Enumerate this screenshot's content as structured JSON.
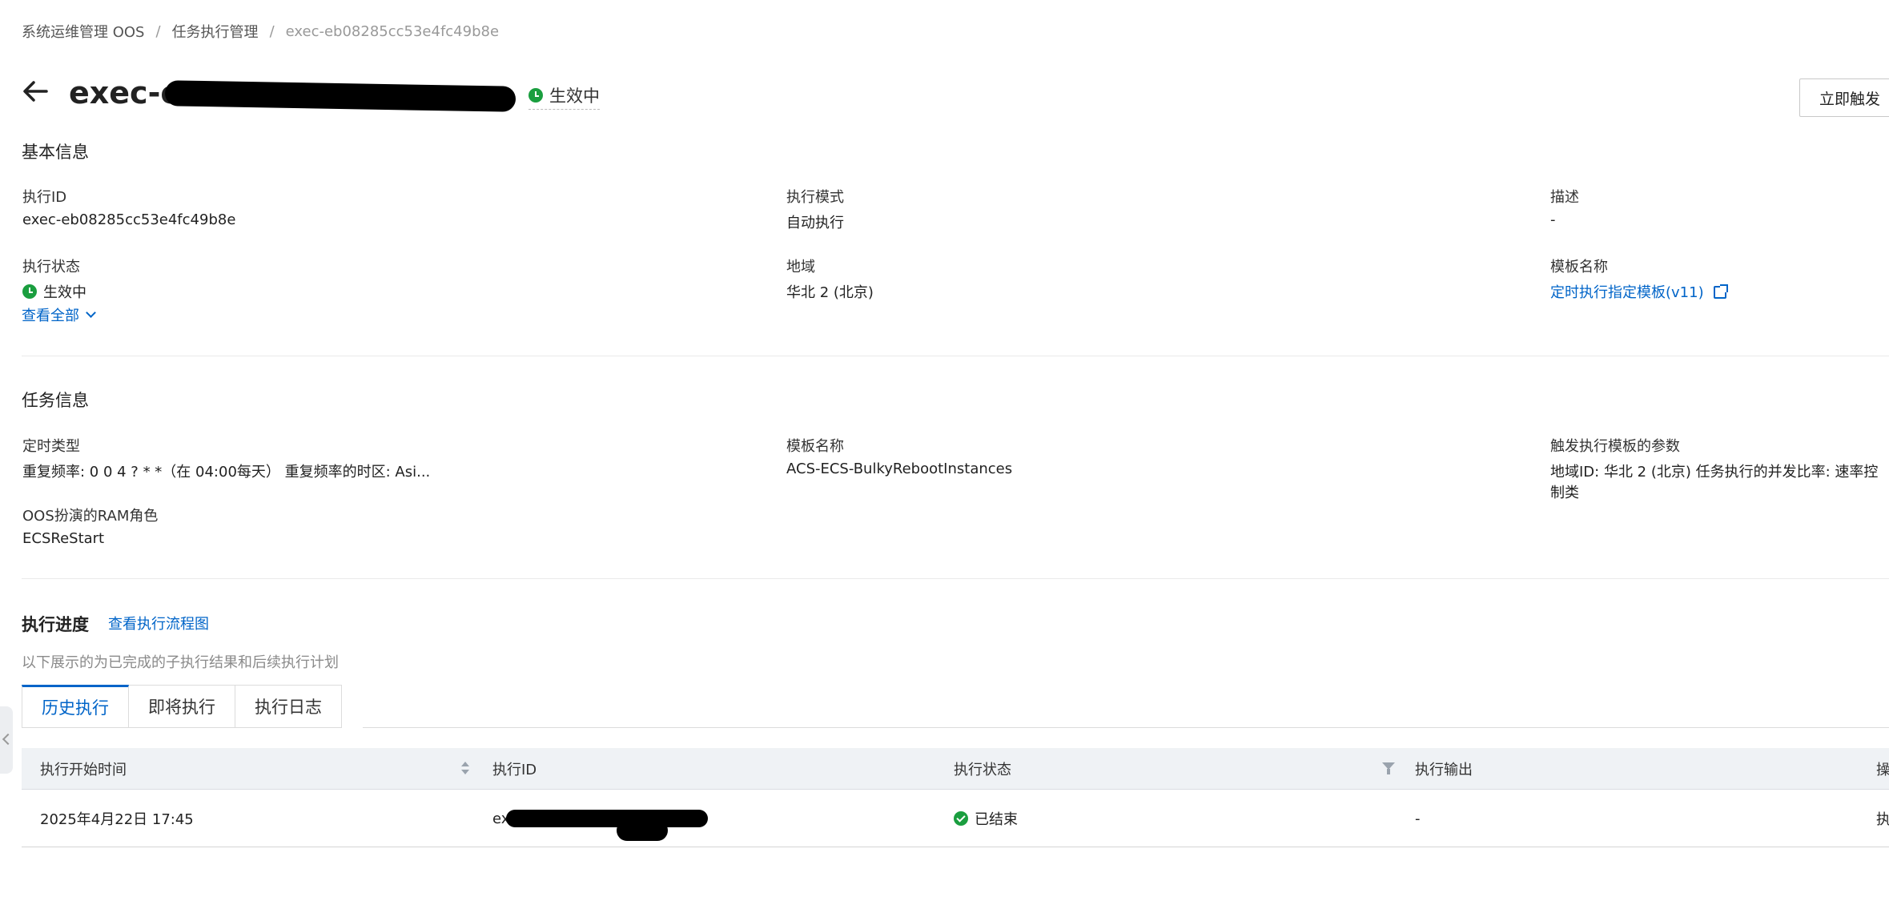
{
  "breadcrumb": {
    "items": [
      "系统运维管理 OOS",
      "任务执行管理"
    ],
    "current": "exec-eb08285cc53e4fc49b8e",
    "separator": "/"
  },
  "header": {
    "title_prefix": "exec-e",
    "status": "生效中",
    "trigger_button": "立即触发"
  },
  "basic_info": {
    "title": "基本信息",
    "fields": {
      "exec_id": {
        "label": "执行ID",
        "value": "exec-eb08285cc53e4fc49b8e"
      },
      "mode": {
        "label": "执行模式",
        "value": "自动执行"
      },
      "desc": {
        "label": "描述",
        "value": "-"
      },
      "status": {
        "label": "执行状态",
        "value": "生效中"
      },
      "region": {
        "label": "地域",
        "value": "华北 2 (北京)"
      },
      "template": {
        "label": "模板名称",
        "value": "定时执行指定模板(v11)"
      }
    },
    "expand_link": "查看全部"
  },
  "task_info": {
    "title": "任务信息",
    "fields": {
      "schedule": {
        "label": "定时类型",
        "value": "重复频率: 0 0 4 ? * *（在 04:00每天） 重复频率的时区: Asi..."
      },
      "template": {
        "label": "模板名称",
        "value": "ACS-ECS-BulkyRebootInstances"
      },
      "params": {
        "label": "触发执行模板的参数",
        "value": "地域ID: 华北 2 (北京) 任务执行的并发比率: 速率控制类"
      },
      "ram_role": {
        "label": "OOS扮演的RAM角色",
        "value": "ECSReStart"
      }
    }
  },
  "progress": {
    "title": "执行进度",
    "flow_link": "查看执行流程图",
    "hint": "以下展示的为已完成的子执行结果和后续执行计划",
    "tabs": [
      "历史执行",
      "即将执行",
      "执行日志"
    ],
    "active_tab": 0
  },
  "table": {
    "columns": [
      "执行开始时间",
      "执行ID",
      "执行状态",
      "执行输出",
      "操"
    ],
    "rows": [
      {
        "start_time": "2025年4月22日 17:45",
        "exec_id_prefix": "ex",
        "status": "已结束",
        "output": "-",
        "action": "执"
      }
    ]
  },
  "colors": {
    "link": "#0064c8",
    "success": "#1a9e3f",
    "table_header_bg": "#eff2f5"
  }
}
